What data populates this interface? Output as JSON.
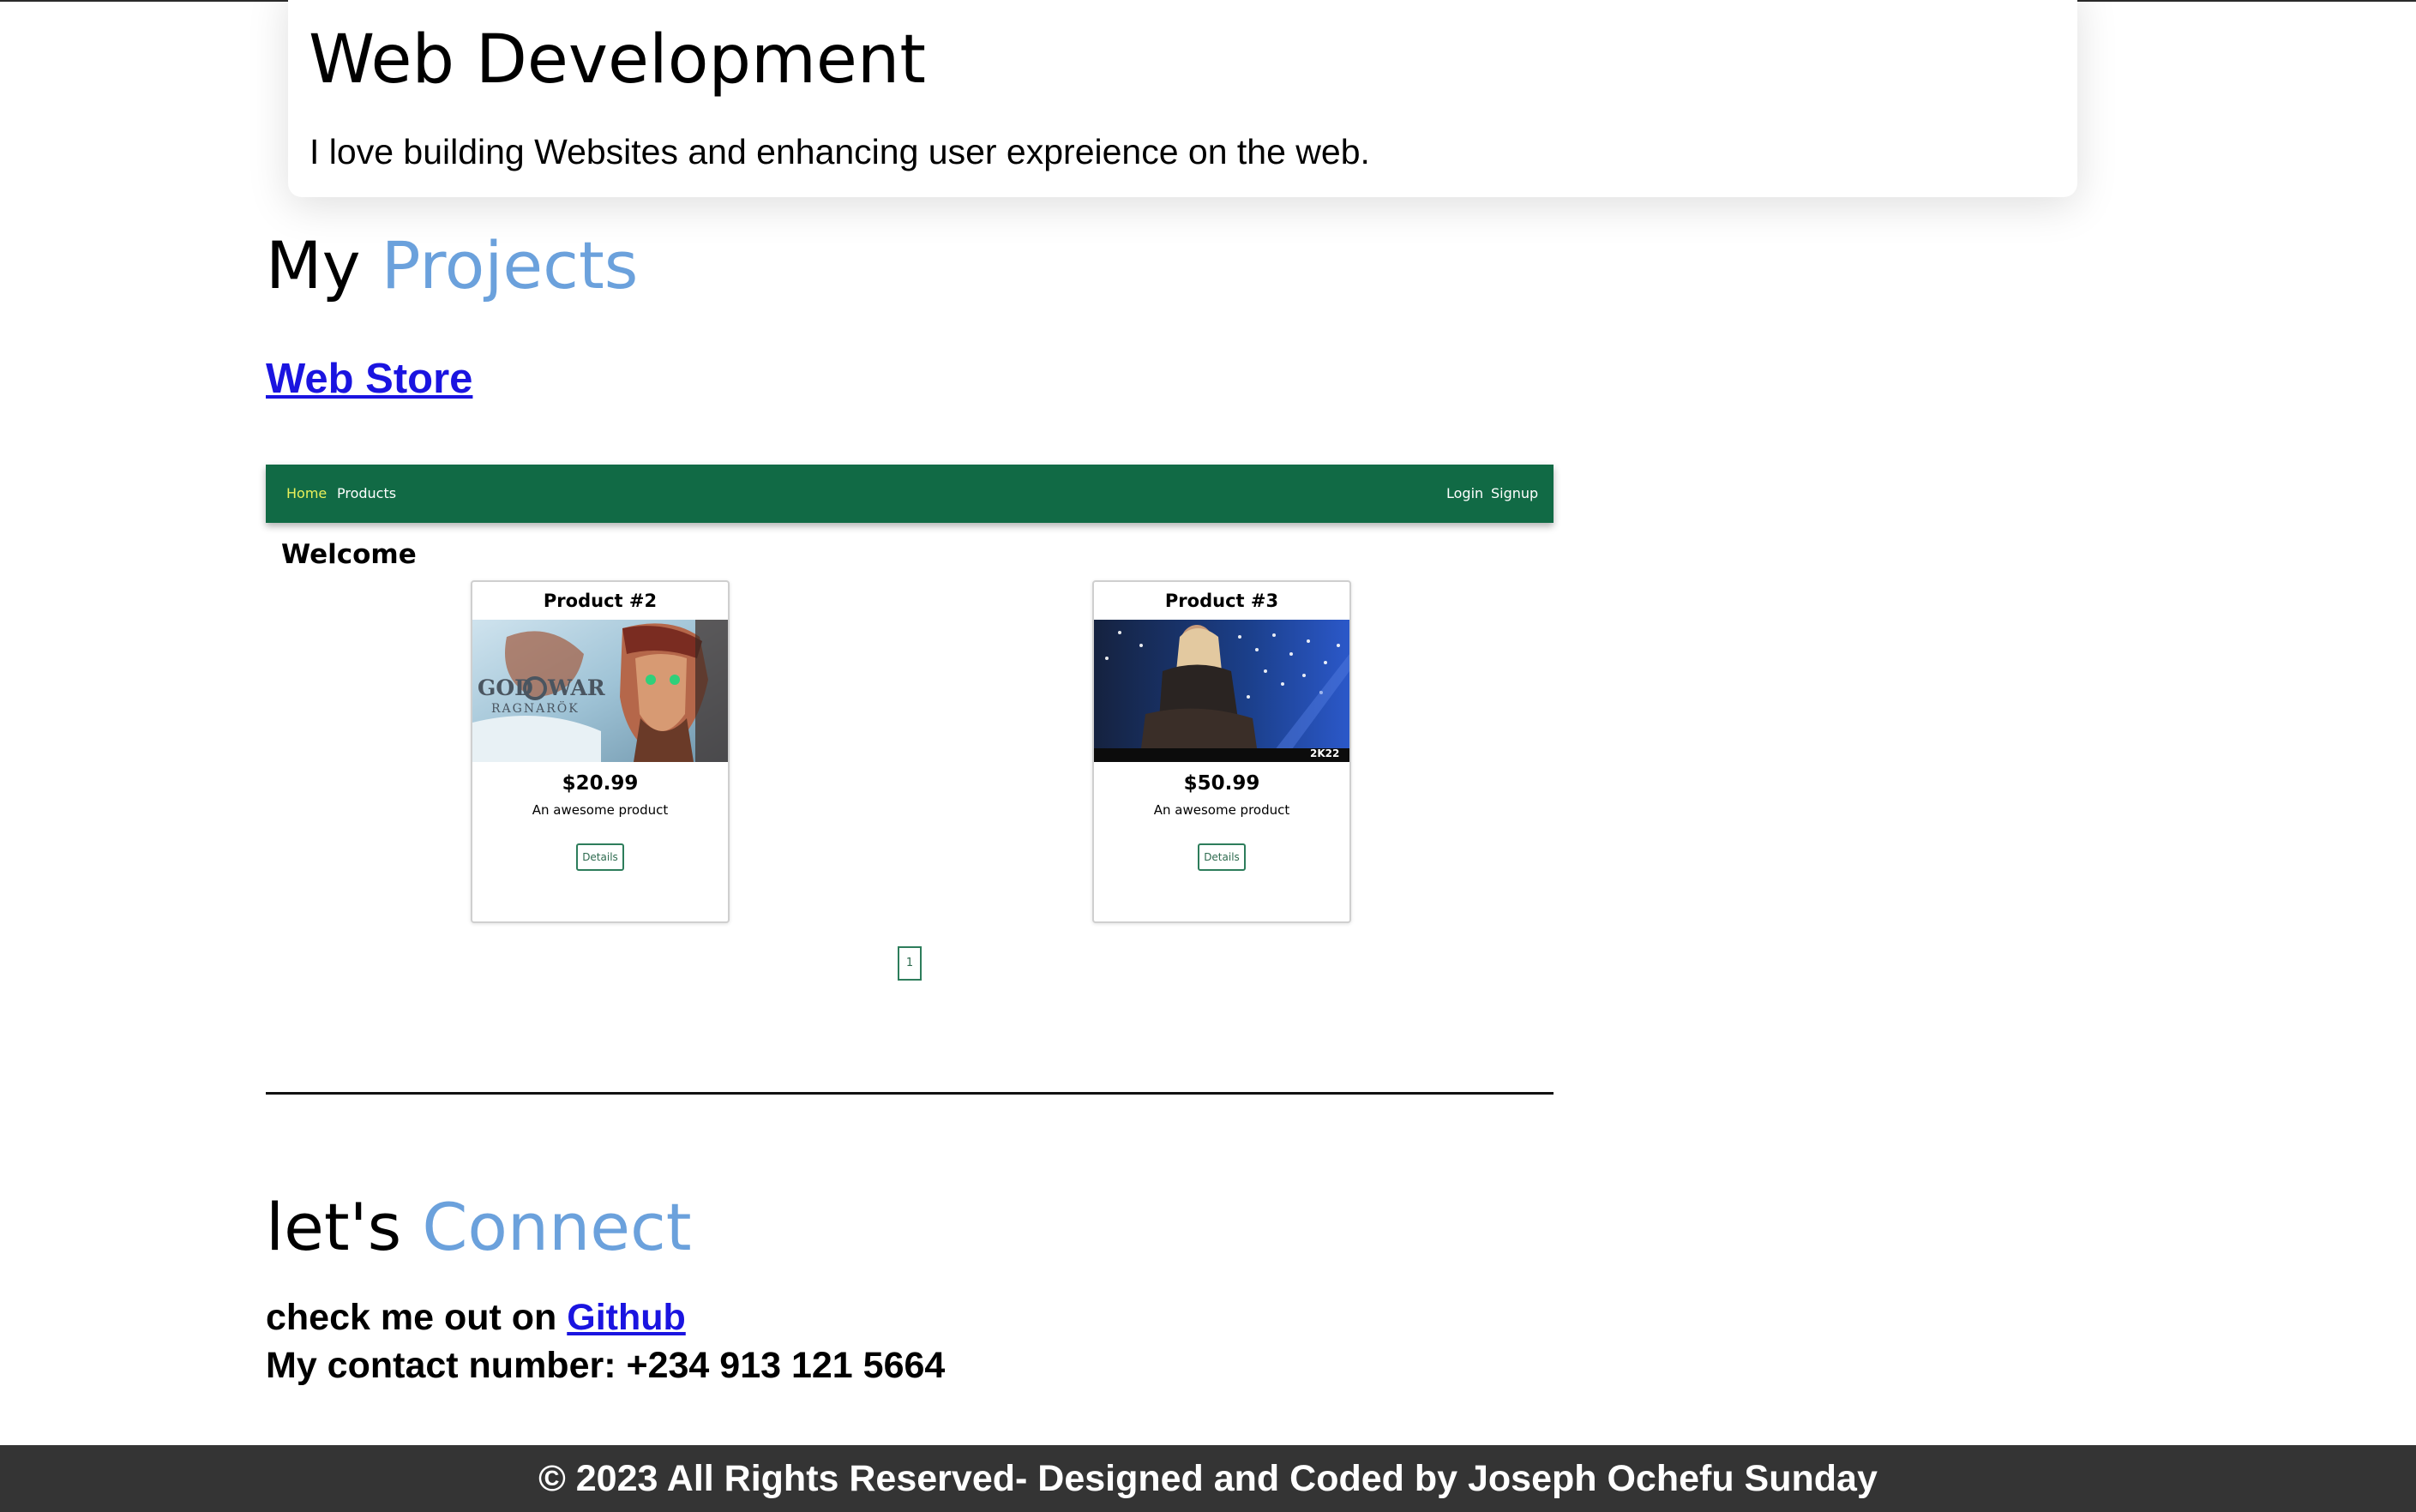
{
  "skill": {
    "title": "Web Development",
    "description": "I love building Websites and enhancing user expreience on the web."
  },
  "projects": {
    "heading_plain": "My",
    "heading_accent": "Projects",
    "items": [
      {
        "link_text": "Web Store",
        "preview": {
          "nav": {
            "home": "Home",
            "products": "Products",
            "login": "Login",
            "signup": "Signup"
          },
          "welcome": "Welcome",
          "cards": [
            {
              "title": "Product #2",
              "price": "$20.99",
              "description": "An awesome product",
              "button": "Details",
              "image_caption": "GOD OF WAR RAGNARÖK"
            },
            {
              "title": "Product #3",
              "price": "$50.99",
              "description": "An awesome product",
              "button": "Details",
              "image_caption": "2K22"
            }
          ],
          "page_number": "1"
        }
      }
    ]
  },
  "connect": {
    "heading_plain": "let's",
    "heading_accent": "Connect",
    "github_prefix": "check me out on",
    "github_link": "Github",
    "phone_line": "My contact number: +234 913 121 5664"
  },
  "footer": {
    "text": "© 2023 All Rights Reserved- Designed and Coded by Joseph Ochefu Sunday"
  },
  "colors": {
    "accent": "#6ba1dc",
    "link": "#1a14e0",
    "nav_green": "#116a45",
    "footer_bg": "#343434"
  }
}
